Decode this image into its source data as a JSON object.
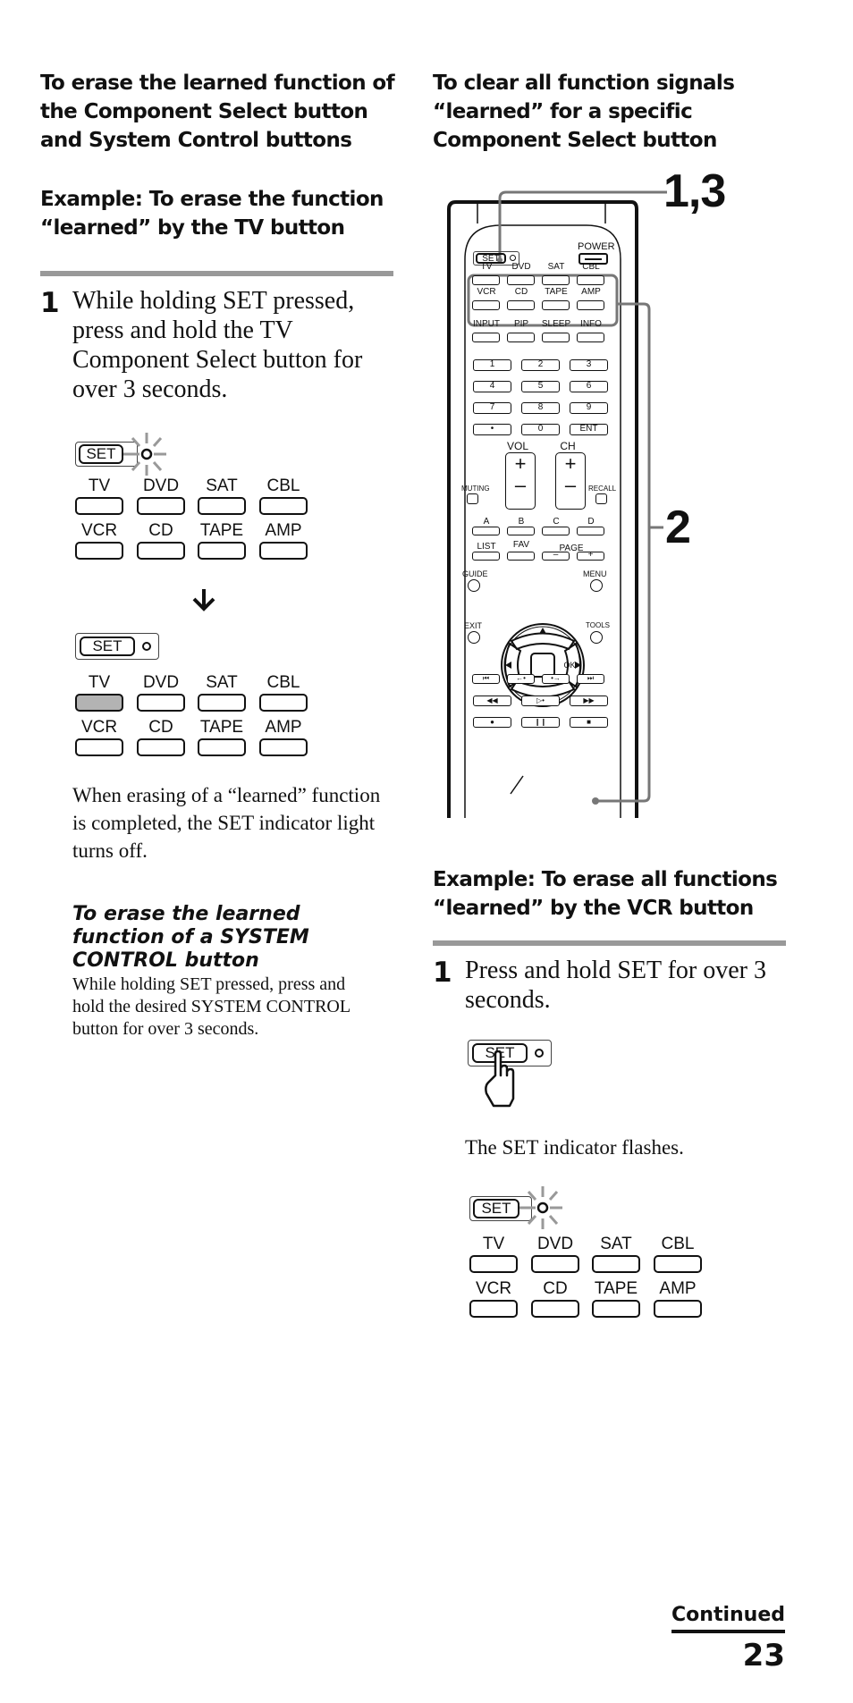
{
  "left": {
    "heading": "To erase the learned function of the Component Select button and System Control buttons",
    "example_heading": "Example: To erase the function “learned” by the TV button",
    "step1": {
      "number": "1",
      "text": "While holding SET pressed, press and hold the TV Component Select button for over 3 seconds."
    },
    "diagram_before": {
      "set_label": "SET",
      "indicator_state": "flashing",
      "row1": [
        "TV",
        "DVD",
        "SAT",
        "CBL"
      ],
      "row2": [
        "VCR",
        "CD",
        "TAPE",
        "AMP"
      ]
    },
    "arrow_icon": "arrow-down-icon",
    "diagram_after": {
      "set_label": "SET",
      "indicator_state": "off",
      "row1": [
        "TV",
        "DVD",
        "SAT",
        "CBL"
      ],
      "row2": [
        "VCR",
        "CD",
        "TAPE",
        "AMP"
      ],
      "highlighted": "TV",
      "highlight_color": "#b3b3b3"
    },
    "completion_note": "When erasing of  a “learned” function is completed, the SET indicator light turns off.",
    "subsection": {
      "title": "To erase the learned function of a SYSTEM CONTROL button",
      "text": "While holding SET pressed, press and hold the desired SYSTEM CONTROL button for over 3 seconds."
    }
  },
  "right": {
    "heading": "To clear all function signals “learned” for a specific Component Select button",
    "remote": {
      "callout_1": "1,3",
      "callout_2": "2",
      "set_label": "SET",
      "power_label": "POWER",
      "component_row1": [
        "TV",
        "DVD",
        "SAT",
        "CBL"
      ],
      "component_row2": [
        "VCR",
        "CD",
        "TAPE",
        "AMP"
      ],
      "function_row": [
        "INPUT",
        "PIP",
        "SLEEP",
        "INFO"
      ],
      "number_rows": [
        [
          "1",
          "2",
          "3"
        ],
        [
          "4",
          "5",
          "6"
        ],
        [
          "7",
          "8",
          "9"
        ],
        [
          "•",
          "0",
          "ENT"
        ]
      ],
      "vol_label": "VOL",
      "ch_label": "CH",
      "muting_label": "MUTING",
      "recall_label": "RECALL",
      "abcd_row": [
        "A",
        "B",
        "C",
        "D"
      ],
      "list_label": "LIST",
      "fav_label": "FAV",
      "page_label": "PAGE",
      "guide_label": "GUIDE",
      "menu_label": "MENU",
      "exit_label": "EXIT",
      "tools_label": "TOOLS",
      "ok_label": "OK",
      "callout_color": "#777777"
    },
    "example_heading": "Example: To erase all functions “learned” by the VCR button",
    "step1": {
      "number": "1",
      "text": "Press and hold SET for over 3 seconds."
    },
    "diagram_press": {
      "set_label": "SET",
      "icon": "pointing-hand-icon"
    },
    "flash_note": "The SET indicator flashes.",
    "diagram_flash": {
      "set_label": "SET",
      "indicator_state": "flashing",
      "row1": [
        "TV",
        "DVD",
        "SAT",
        "CBL"
      ],
      "row2": [
        "VCR",
        "CD",
        "TAPE",
        "AMP"
      ]
    }
  },
  "footer": {
    "continued": "Continued",
    "page_number": "23"
  }
}
